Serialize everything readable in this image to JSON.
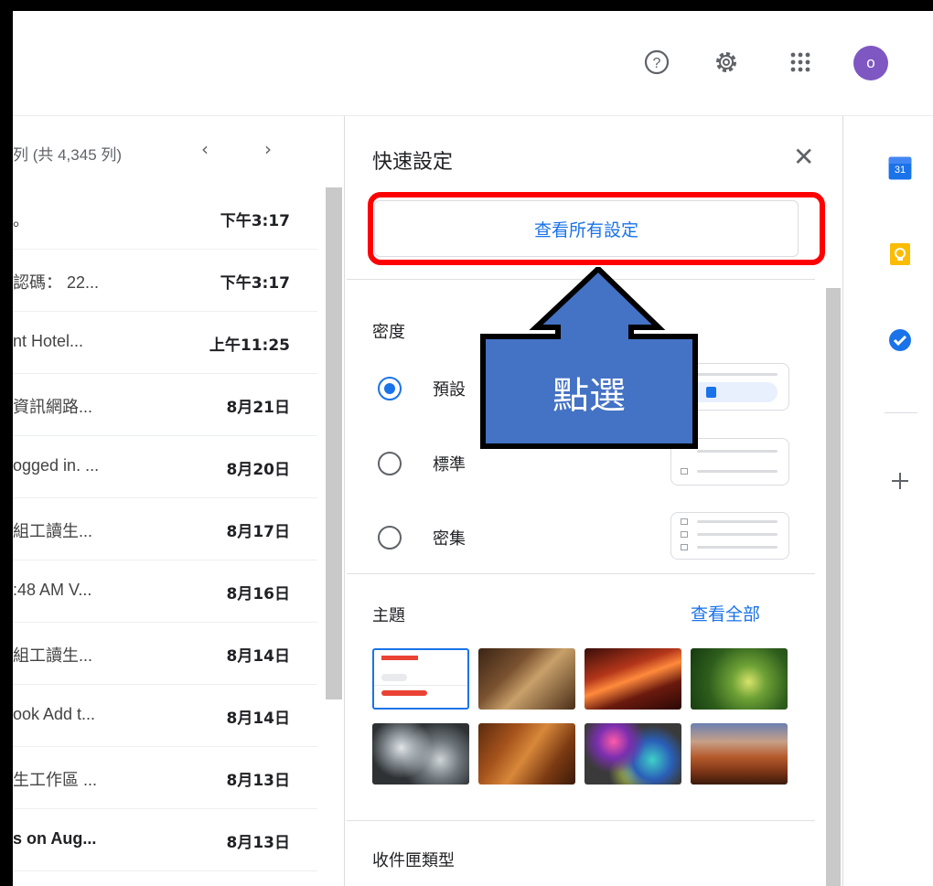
{
  "header": {
    "help_icon": "help-circle-icon",
    "settings_icon": "gear-icon",
    "apps_icon": "apps-grid-icon",
    "avatar_initial": "o"
  },
  "email_list": {
    "count_text": "列 (共 4,345 列)",
    "prev": "‹",
    "next": "›",
    "rows": [
      {
        "subject": "。",
        "date": "下午3:17",
        "unread": false
      },
      {
        "subject": "認碼： 22...",
        "date": "下午3:17",
        "unread": false
      },
      {
        "subject": "nt Hotel...",
        "date": "上午11:25",
        "unread": false
      },
      {
        "subject": "資訊網路...",
        "date": "8月21日",
        "unread": false
      },
      {
        "subject": "ogged in. ...",
        "date": "8月20日",
        "unread": false
      },
      {
        "subject": "組工讀生...",
        "date": "8月17日",
        "unread": false
      },
      {
        "subject": ":48 AM V...",
        "date": "8月16日",
        "unread": false
      },
      {
        "subject": "組工讀生...",
        "date": "8月14日",
        "unread": false
      },
      {
        "subject": "ook Add t...",
        "date": "8月14日",
        "unread": false
      },
      {
        "subject": "生工作區 ...",
        "date": "8月13日",
        "unread": false
      },
      {
        "subject": "s on Aug...",
        "date": "8月13日",
        "unread": true
      }
    ]
  },
  "quick_settings": {
    "title": "快速設定",
    "close": "✕",
    "see_all_settings": "查看所有設定",
    "density": {
      "label": "密度",
      "options": [
        {
          "label": "預設",
          "selected": true
        },
        {
          "label": "標準",
          "selected": false
        },
        {
          "label": "密集",
          "selected": false
        }
      ]
    },
    "theme": {
      "label": "主題",
      "see_all": "查看全部",
      "thumbnails": [
        "default-gmail",
        "chess",
        "canyon",
        "green-leaf",
        "bubbles",
        "autumn-leaves",
        "colorful-lights",
        "canyon-river"
      ]
    },
    "inbox_type": {
      "label": "收件匣類型"
    }
  },
  "annotation": {
    "label": "點選",
    "arrow_color": "#4472c4",
    "highlight_color": "#ff0000"
  },
  "side_panel": {
    "calendar_day": "31",
    "icons": [
      "calendar-icon",
      "keep-icon",
      "tasks-icon",
      "add-icon"
    ]
  }
}
